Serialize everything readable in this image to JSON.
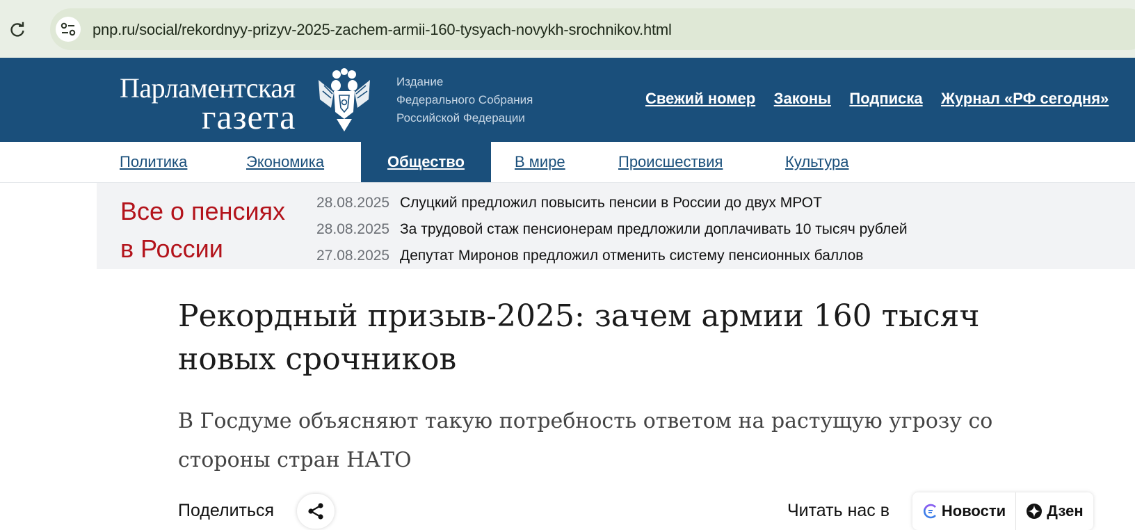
{
  "browser": {
    "url": "pnp.ru/social/rekordnyy-prizyv-2025-zachem-armii-160-tysyach-novykh-srochnikov.html",
    "icons": [
      "reload-icon",
      "site-info-icon"
    ]
  },
  "header": {
    "logo_line1": "Парламентская",
    "logo_line2": "газета",
    "emblem_icon": "double-headed-eagle-emblem",
    "publisher_note": [
      "Издание",
      "Федерального Собрания",
      "Российской Федерации"
    ],
    "top_links": [
      "Свежий номер",
      "Законы",
      "Подписка",
      "Журнал «РФ сегодня»"
    ],
    "brand_color": "#1a4f7b"
  },
  "section_nav": {
    "items": [
      "Политика",
      "Экономика",
      "Общество",
      "В мире",
      "Происшествия",
      "Культура"
    ],
    "active": "Общество"
  },
  "pensions": {
    "title_line1": "Все о пенсиях",
    "title_line2": "в России",
    "title_color": "#b3131b",
    "news": [
      {
        "date": "28.08.2025",
        "headline": "Слуцкий предложил повысить пенсии в России до двух МРОТ"
      },
      {
        "date": "28.08.2025",
        "headline": "За трудовой стаж пенсионерам предложили доплачивать 10 тысяч рублей"
      },
      {
        "date": "27.08.2025",
        "headline": "Депутат Миронов предложил отменить систему пенсионных баллов"
      }
    ]
  },
  "article": {
    "title": "Рекордный призыв-2025: зачем армии 160 тысяч новых срочников",
    "lead": "В Госдуме объясняют такую потребность ответом на растущую угрозу со стороны стран НАТО"
  },
  "share": {
    "label": "Поделиться",
    "icon": "share-icon"
  },
  "follow": {
    "label": "Читать нас в",
    "services": [
      "Новости",
      "Дзен"
    ],
    "icons": [
      "news-icon",
      "dzen-icon"
    ]
  }
}
